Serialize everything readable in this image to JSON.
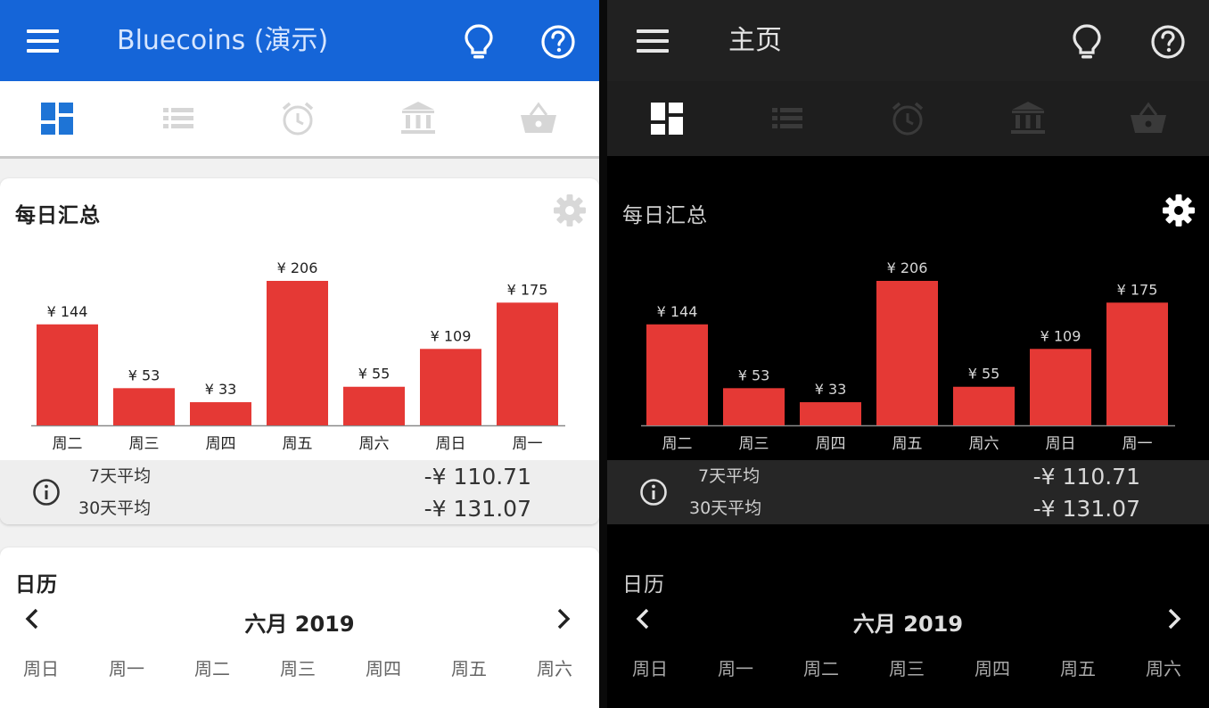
{
  "colors": {
    "light_appbar": "#1565d8",
    "dark_appbar": "#212121",
    "bar": "#e53935",
    "tab_active_light": "#1e74d6",
    "tab_active_dark": "#ffffff"
  },
  "light": {
    "app_title": "Bluecoins (演示)",
    "summary": {
      "title": "每日汇总"
    },
    "averages": {
      "label_7": "7天平均",
      "value_7": "-¥ 110.71",
      "label_30": "30天平均",
      "value_30": "-¥ 131.07"
    },
    "calendar": {
      "title": "日历",
      "month": "六月 2019"
    }
  },
  "dark": {
    "app_title": "主页",
    "summary": {
      "title": "每日汇总"
    },
    "averages": {
      "label_7": "7天平均",
      "value_7": "-¥ 110.71",
      "label_30": "30天平均",
      "value_30": "-¥ 131.07"
    },
    "calendar": {
      "title": "日历",
      "month": "六月 2019"
    }
  },
  "tabs": [
    "dashboard-icon",
    "list-icon",
    "alarm-clock-icon",
    "bank-icon",
    "shopping-basket-icon"
  ],
  "weekdays": [
    "周日",
    "周一",
    "周二",
    "周三",
    "周四",
    "周五",
    "周六"
  ],
  "chart_data": [
    {
      "type": "bar",
      "categories": [
        "周二",
        "周三",
        "周四",
        "周五",
        "周六",
        "周日",
        "周一"
      ],
      "values": [
        144,
        53,
        33,
        206,
        55,
        109,
        175
      ],
      "data_labels": [
        "¥ 144",
        "¥ 53",
        "¥ 33",
        "¥ 206",
        "¥ 55",
        "¥ 109",
        "¥ 175"
      ],
      "ylim": [
        0,
        206
      ],
      "grid": false
    },
    {
      "type": "bar",
      "categories": [
        "周二",
        "周三",
        "周四",
        "周五",
        "周六",
        "周日",
        "周一"
      ],
      "values": [
        144,
        53,
        33,
        206,
        55,
        109,
        175
      ],
      "data_labels": [
        "¥ 144",
        "¥ 53",
        "¥ 33",
        "¥ 206",
        "¥ 55",
        "¥ 109",
        "¥ 175"
      ],
      "ylim": [
        0,
        206
      ],
      "grid": false
    }
  ]
}
